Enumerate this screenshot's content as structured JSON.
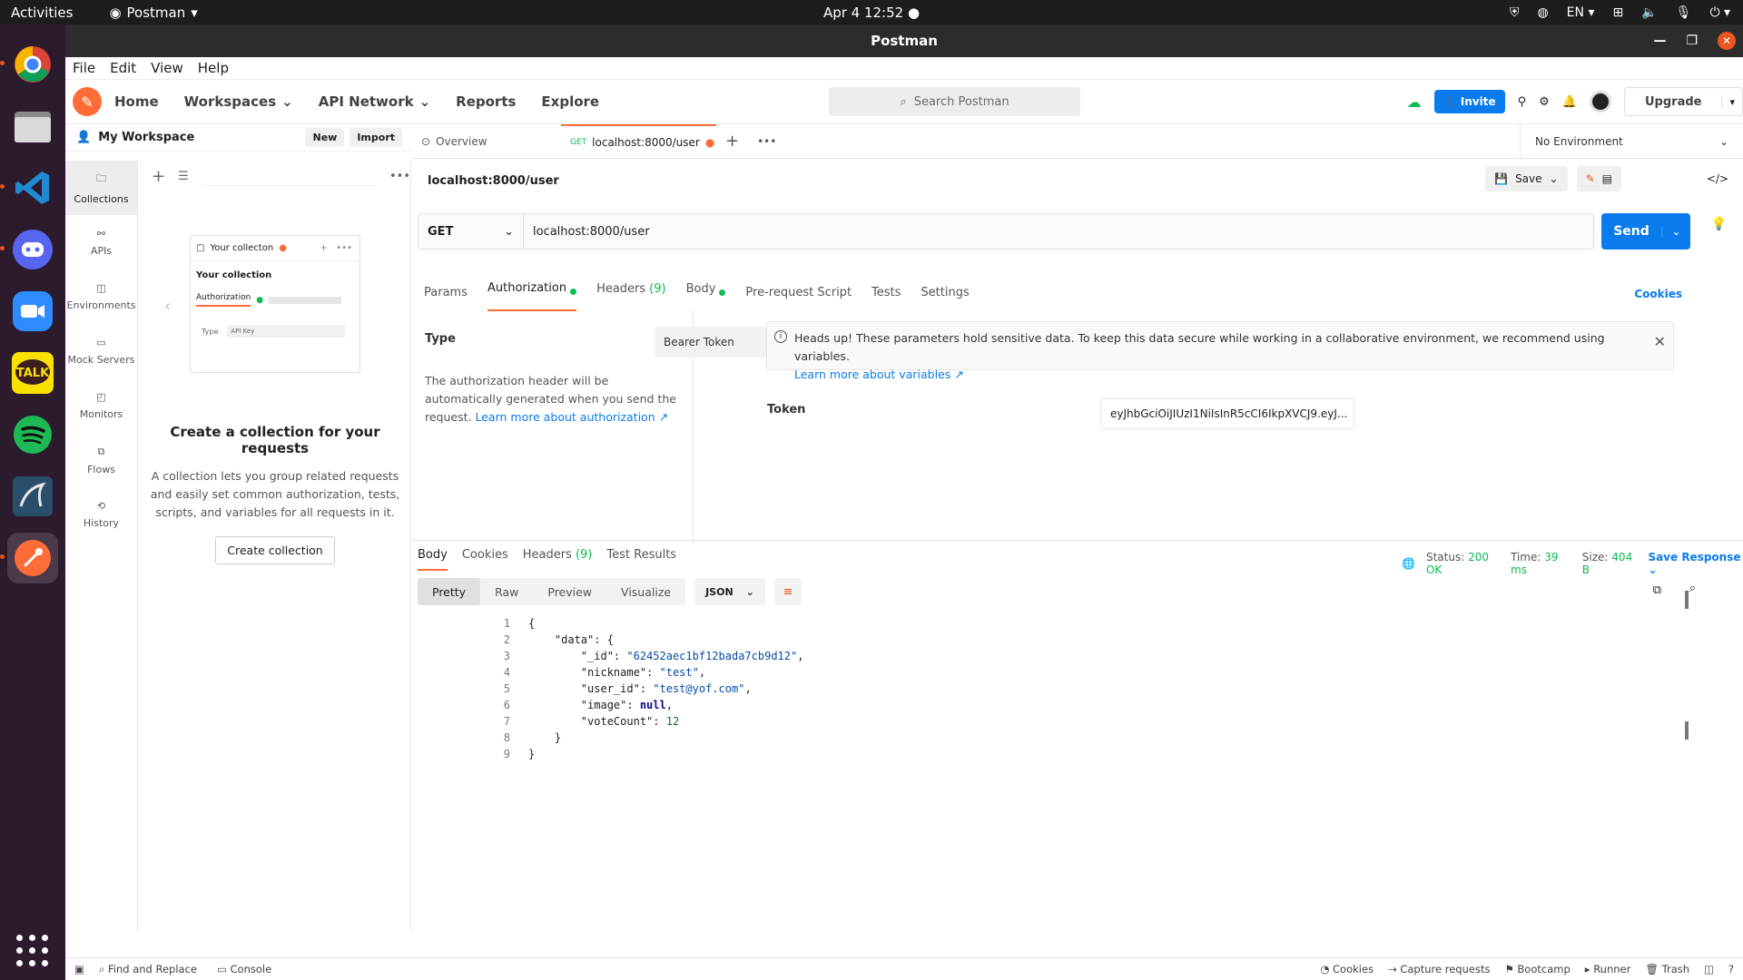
{
  "os": {
    "activities": "Activities",
    "app_name": "Postman",
    "clock": "Apr 4  12:52",
    "lang": "EN"
  },
  "window": {
    "title": "Postman"
  },
  "menu": [
    "File",
    "Edit",
    "View",
    "Help"
  ],
  "header": {
    "nav": [
      "Home",
      "Workspaces",
      "API Network",
      "Reports",
      "Explore"
    ],
    "search_placeholder": "Search Postman",
    "invite": "Invite",
    "upgrade": "Upgrade"
  },
  "workspace": {
    "name": "My Workspace",
    "new": "New",
    "import": "Import"
  },
  "rail": [
    {
      "label": "Collections",
      "icon": "collections-icon"
    },
    {
      "label": "APIs",
      "icon": "apis-icon"
    },
    {
      "label": "Environments",
      "icon": "environments-icon"
    },
    {
      "label": "Mock Servers",
      "icon": "mock-servers-icon"
    },
    {
      "label": "Monitors",
      "icon": "monitors-icon"
    },
    {
      "label": "Flows",
      "icon": "flows-icon"
    },
    {
      "label": "History",
      "icon": "history-icon"
    }
  ],
  "collections": {
    "preview_tab": "Your collecton",
    "preview_title": "Your collection",
    "preview_auth": "Authorization",
    "preview_type": "Type",
    "preview_value": "API Key",
    "empty_title": "Create a collection for your requests",
    "empty_desc": "A collection lets you group related requests and easily set common authorization, tests, scripts, and variables for all requests in it.",
    "create_button": "Create collection"
  },
  "tabs": {
    "overview": "Overview",
    "active_method": "GET",
    "active_url": "localhost:8000/user",
    "environment": "No Environment"
  },
  "request": {
    "title": "localhost:8000/user",
    "save": "Save",
    "method": "GET",
    "url": "localhost:8000/user",
    "send": "Send",
    "tabs": [
      "Params",
      "Authorization",
      "Headers",
      "Body",
      "Pre-request Script",
      "Tests",
      "Settings"
    ],
    "headers_count": "(9)",
    "cookies": "Cookies"
  },
  "auth": {
    "type_label": "Type",
    "type_value": "Bearer Token",
    "desc": "The authorization header will be automatically generated when you send the request.",
    "desc_link": "Learn more about authorization ↗",
    "alert": "Heads up! These parameters hold sensitive data. To keep this data secure while working in a collaborative environment, we recommend using variables.",
    "alert_link": "Learn more about variables ↗",
    "token_label": "Token",
    "token_value": "eyJhbGciOiJIUzI1NiIsInR5cCI6IkpXVCJ9.eyJ..."
  },
  "response": {
    "tabs": [
      "Body",
      "Cookies",
      "Headers",
      "Test Results"
    ],
    "headers_count": "(9)",
    "status_label": "Status:",
    "status": "200 OK",
    "time_label": "Time:",
    "time": "39 ms",
    "size_label": "Size:",
    "size": "404 B",
    "save_response": "Save Response",
    "views": [
      "Pretty",
      "Raw",
      "Preview",
      "Visualize"
    ],
    "format": "JSON",
    "json": {
      "id": "\"62452aec1bf12bada7cb9d12\"",
      "nickname": "\"test\"",
      "user_id": "\"test@yof.com\"",
      "image": "null",
      "voteCount": "12"
    }
  },
  "statusbar": {
    "left": [
      "Find and Replace",
      "Console"
    ],
    "right": [
      "Cookies",
      "Capture requests",
      "Bootcamp",
      "Runner",
      "Trash"
    ]
  },
  "colors": {
    "accent": "#ff6c37",
    "primary": "#097bed",
    "success": "#0cbb52"
  }
}
